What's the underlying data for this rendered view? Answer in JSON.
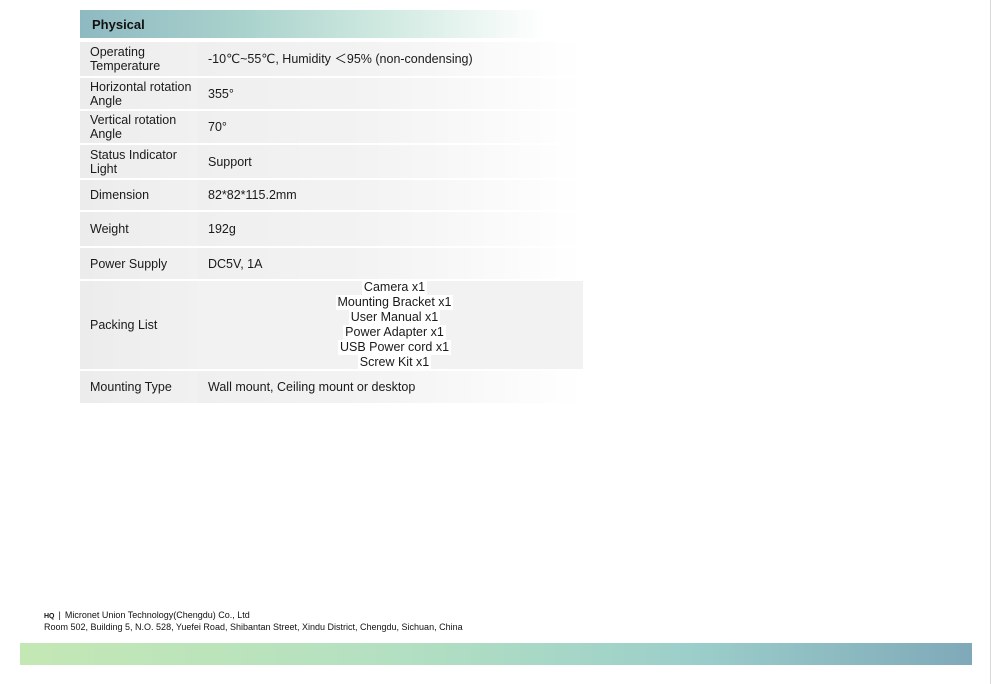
{
  "section": {
    "title": "Physical"
  },
  "rows": [
    {
      "label": "Operating Temperature",
      "value": "-10℃~55℃, Humidity ＜95% (non-condensing)"
    },
    {
      "label": "Horizontal rotation Angle",
      "value": "355°"
    },
    {
      "label": "Vertical rotation Angle",
      "value": "70°"
    },
    {
      "label": "Status Indicator Light",
      "value": "Support"
    },
    {
      "label": "Dimension",
      "value": "82*82*115.2mm"
    },
    {
      "label": "Weight",
      "value": "192g"
    },
    {
      "label": "Power Supply",
      "value": "DC5V, 1A"
    },
    {
      "label": "Packing List",
      "items": [
        "Camera x1",
        "Mounting Bracket x1",
        "User Manual x1",
        "Power Adapter x1",
        "USB Power cord x1",
        "Screw Kit x1"
      ]
    },
    {
      "label": "Mounting Type",
      "value": "Wall mount, Ceiling mount or desktop"
    }
  ],
  "footer": {
    "hq": "HQ",
    "separator": "|",
    "company": "Micronet Union Technology(Chengdu) Co., Ltd",
    "address": "Room 502, Building 5, N.O. 528, Yuefei Road, Shibantan Street, Xindu District, Chengdu, Sichuan, China"
  }
}
